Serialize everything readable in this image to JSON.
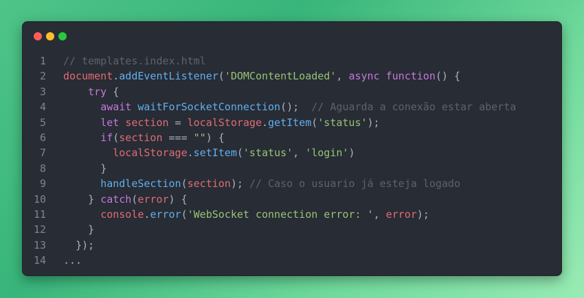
{
  "window": {
    "traffic_lights": {
      "close_color": "#ff5f56",
      "minimize_color": "#ffbd2e",
      "maximize_color": "#27c93f"
    }
  },
  "colors": {
    "plain": "#abb2bf",
    "comment": "#5c6370",
    "variable": "#e06c75",
    "function": "#61afef",
    "string": "#98c379",
    "keyword": "#c678dd",
    "line_number": "#7f848e"
  },
  "code": {
    "lines": [
      {
        "num": "1",
        "indent": "",
        "tokens": [
          {
            "t": "// templates.index.html",
            "c": "comment"
          }
        ]
      },
      {
        "num": "2",
        "indent": "",
        "tokens": [
          {
            "t": "document",
            "c": "variable"
          },
          {
            "t": ".",
            "c": "plain"
          },
          {
            "t": "addEventListener",
            "c": "function"
          },
          {
            "t": "(",
            "c": "plain"
          },
          {
            "t": "'DOMContentLoaded'",
            "c": "string"
          },
          {
            "t": ", ",
            "c": "plain"
          },
          {
            "t": "async",
            "c": "keyword"
          },
          {
            "t": " ",
            "c": "plain"
          },
          {
            "t": "function",
            "c": "keyword"
          },
          {
            "t": "() {",
            "c": "plain"
          }
        ]
      },
      {
        "num": "3",
        "indent": "    ",
        "tokens": [
          {
            "t": "try",
            "c": "keyword"
          },
          {
            "t": " {",
            "c": "plain"
          }
        ]
      },
      {
        "num": "4",
        "indent": "      ",
        "tokens": [
          {
            "t": "await",
            "c": "keyword"
          },
          {
            "t": " ",
            "c": "plain"
          },
          {
            "t": "waitForSocketConnection",
            "c": "function"
          },
          {
            "t": "();  ",
            "c": "plain"
          },
          {
            "t": "// Aguarda a conexão estar aberta",
            "c": "comment"
          }
        ]
      },
      {
        "num": "5",
        "indent": "      ",
        "tokens": [
          {
            "t": "let",
            "c": "keyword"
          },
          {
            "t": " ",
            "c": "plain"
          },
          {
            "t": "section",
            "c": "variable"
          },
          {
            "t": " = ",
            "c": "plain"
          },
          {
            "t": "localStorage",
            "c": "variable"
          },
          {
            "t": ".",
            "c": "plain"
          },
          {
            "t": "getItem",
            "c": "function"
          },
          {
            "t": "(",
            "c": "plain"
          },
          {
            "t": "'status'",
            "c": "string"
          },
          {
            "t": ");",
            "c": "plain"
          }
        ]
      },
      {
        "num": "6",
        "indent": "      ",
        "tokens": [
          {
            "t": "if",
            "c": "keyword"
          },
          {
            "t": "(",
            "c": "plain"
          },
          {
            "t": "section",
            "c": "variable"
          },
          {
            "t": " === ",
            "c": "plain"
          },
          {
            "t": "\"\"",
            "c": "string"
          },
          {
            "t": ") {",
            "c": "plain"
          }
        ]
      },
      {
        "num": "7",
        "indent": "        ",
        "tokens": [
          {
            "t": "localStorage",
            "c": "variable"
          },
          {
            "t": ".",
            "c": "plain"
          },
          {
            "t": "setItem",
            "c": "function"
          },
          {
            "t": "(",
            "c": "plain"
          },
          {
            "t": "'status'",
            "c": "string"
          },
          {
            "t": ", ",
            "c": "plain"
          },
          {
            "t": "'login'",
            "c": "string"
          },
          {
            "t": ")",
            "c": "plain"
          }
        ]
      },
      {
        "num": "8",
        "indent": "      ",
        "tokens": [
          {
            "t": "}",
            "c": "plain"
          }
        ]
      },
      {
        "num": "9",
        "indent": "      ",
        "tokens": [
          {
            "t": "handleSection",
            "c": "function"
          },
          {
            "t": "(",
            "c": "plain"
          },
          {
            "t": "section",
            "c": "variable"
          },
          {
            "t": "); ",
            "c": "plain"
          },
          {
            "t": "// Caso o usuario já esteja logado",
            "c": "comment"
          }
        ]
      },
      {
        "num": "10",
        "indent": "    ",
        "tokens": [
          {
            "t": "} ",
            "c": "plain"
          },
          {
            "t": "catch",
            "c": "keyword"
          },
          {
            "t": "(",
            "c": "plain"
          },
          {
            "t": "error",
            "c": "variable"
          },
          {
            "t": ") {",
            "c": "plain"
          }
        ]
      },
      {
        "num": "11",
        "indent": "      ",
        "tokens": [
          {
            "t": "console",
            "c": "variable"
          },
          {
            "t": ".",
            "c": "plain"
          },
          {
            "t": "error",
            "c": "function"
          },
          {
            "t": "(",
            "c": "plain"
          },
          {
            "t": "'WebSocket connection error: '",
            "c": "string"
          },
          {
            "t": ", ",
            "c": "plain"
          },
          {
            "t": "error",
            "c": "variable"
          },
          {
            "t": ");",
            "c": "plain"
          }
        ]
      },
      {
        "num": "12",
        "indent": "    ",
        "tokens": [
          {
            "t": "}",
            "c": "plain"
          }
        ]
      },
      {
        "num": "13",
        "indent": "  ",
        "tokens": [
          {
            "t": "});",
            "c": "plain"
          }
        ]
      },
      {
        "num": "14",
        "indent": "",
        "tokens": [
          {
            "t": "...",
            "c": "plain"
          }
        ]
      }
    ]
  }
}
